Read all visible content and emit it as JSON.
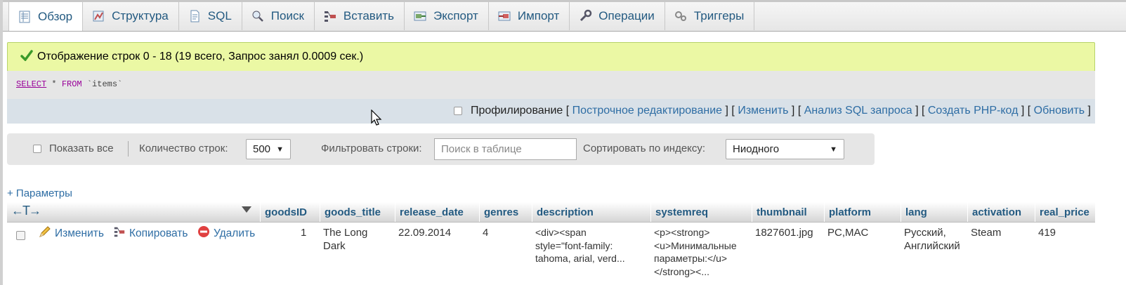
{
  "tabs": [
    {
      "label": "Обзор",
      "icon": "browse-icon",
      "active": true
    },
    {
      "label": "Структура",
      "icon": "structure-icon"
    },
    {
      "label": "SQL",
      "icon": "sql-icon"
    },
    {
      "label": "Поиск",
      "icon": "search-icon"
    },
    {
      "label": "Вставить",
      "icon": "insert-icon"
    },
    {
      "label": "Экспорт",
      "icon": "export-icon"
    },
    {
      "label": "Импорт",
      "icon": "import-icon"
    },
    {
      "label": "Операции",
      "icon": "operations-icon"
    },
    {
      "label": "Триггеры",
      "icon": "triggers-icon"
    }
  ],
  "success": {
    "message": "Отображение строк 0 - 18 (19 всего, Запрос занял 0.0009 сек.)"
  },
  "sql": {
    "select": "SELECT",
    "rest1": " * ",
    "from": "FROM",
    "rest2": " `items`"
  },
  "profiling": {
    "label": "Профилирование",
    "links": [
      "Построчное редактирование",
      "Изменить",
      "Анализ SQL запроса",
      "Создать PHP-код",
      "Обновить"
    ]
  },
  "nav": {
    "show_all": "Показать все",
    "rows_label": "Количество строк:",
    "rows_value": "500",
    "filter_label": "Фильтровать строки:",
    "filter_placeholder": "Поиск в таблице",
    "sort_label": "Сортировать по индексу:",
    "sort_value": "Ниодного"
  },
  "params_link": "+ Параметры",
  "table": {
    "nav_arrows": "←T→",
    "columns": [
      "goodsID",
      "goods_title",
      "release_date",
      "genres",
      "description",
      "systemreq",
      "thumbnail",
      "platform",
      "lang",
      "activation",
      "real_price"
    ],
    "actions": {
      "edit": "Изменить",
      "copy": "Копировать",
      "delete": "Удалить"
    },
    "row": {
      "goodsID": "1",
      "goods_title": [
        "The Long",
        "Dark"
      ],
      "release_date": "22.09.2014",
      "genres": "4",
      "description": [
        "<div><span",
        "style=\"font-family:",
        "tahoma, arial, verd..."
      ],
      "systemreq": [
        "<p><strong>",
        "<u>Минимальные",
        "параметры:</u>",
        "</strong><..."
      ],
      "thumbnail": "1827601.jpg",
      "platform": "PC,MAC",
      "lang": [
        "Русский,",
        "Английский"
      ],
      "activation": "Steam",
      "real_price": "419"
    }
  },
  "colors": {
    "link": "#2e6da4",
    "header": "#235a81",
    "success_bg": "#ebf8a4",
    "prof_bg": "#d9e1e8"
  }
}
